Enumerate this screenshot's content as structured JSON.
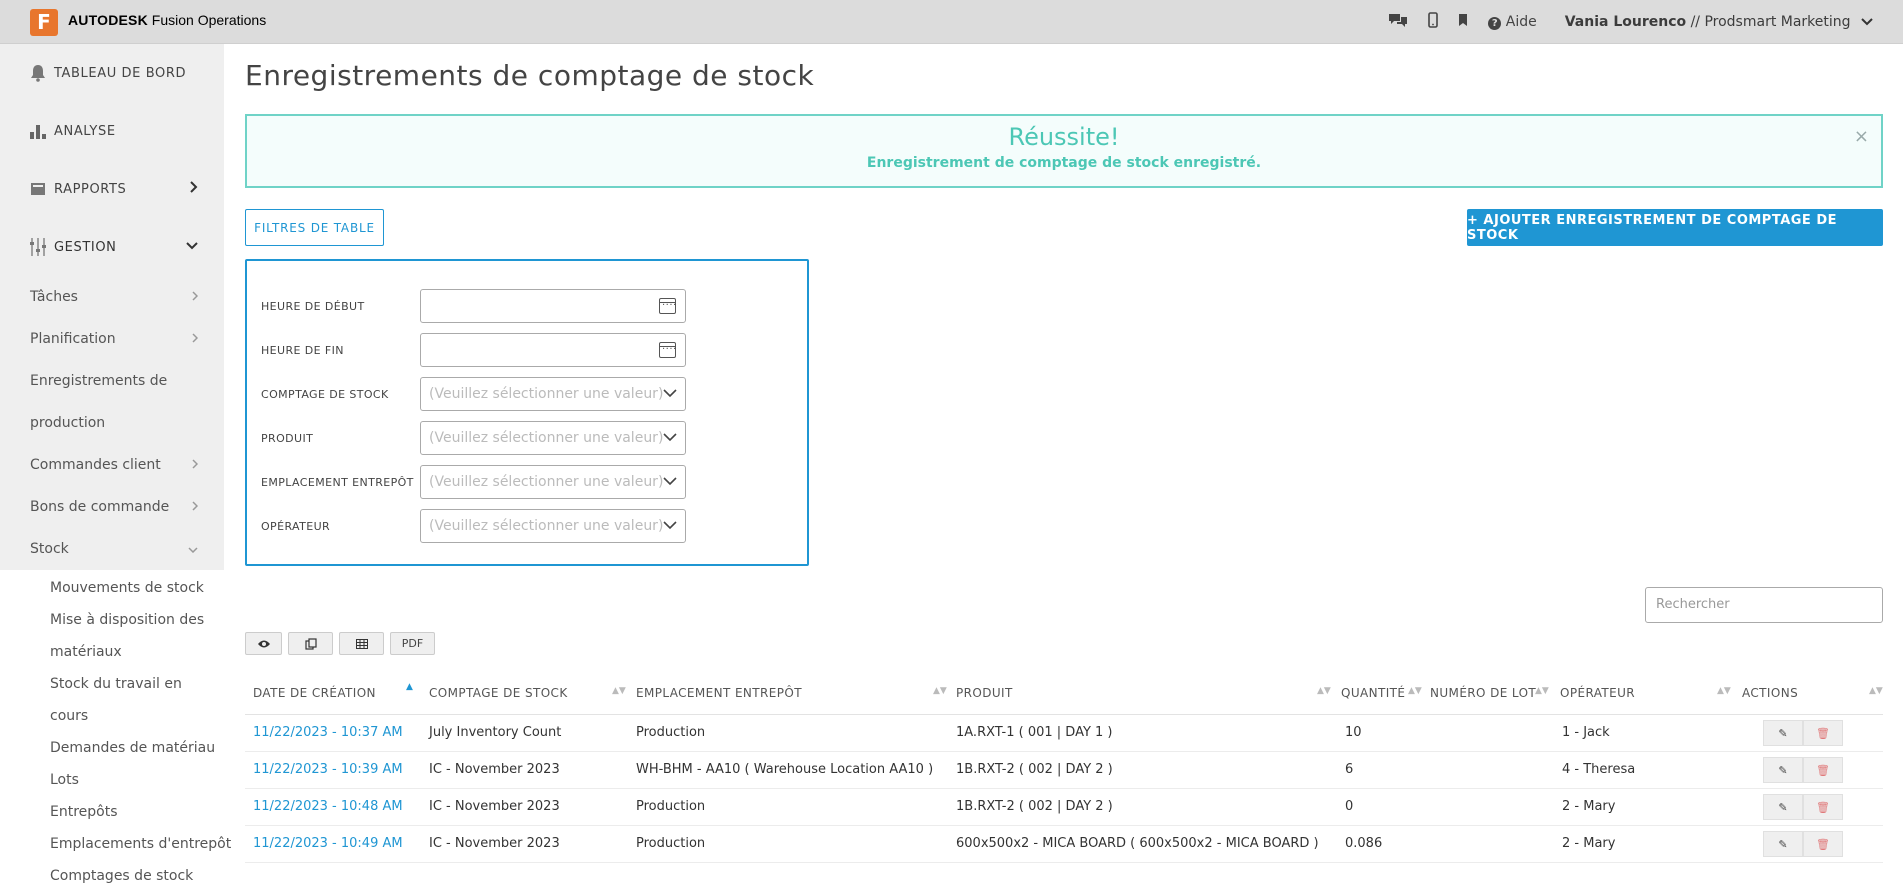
{
  "topbar": {
    "logo_letter": "F",
    "brand_bold": "AUTODESK",
    "brand_rest": "Fusion Operations",
    "help_label": "Aide",
    "user_name": "Vania Lourenco",
    "user_org": " // Prodsmart Marketing"
  },
  "sidebar": {
    "main": [
      {
        "label": "TABLEAU DE BORD",
        "icon": "bell-icon"
      },
      {
        "label": "ANALYSE",
        "icon": "bar-chart-icon"
      },
      {
        "label": "RAPPORTS",
        "icon": "book-icon"
      },
      {
        "label": "GESTION",
        "icon": "sliders-icon"
      }
    ],
    "sub": [
      {
        "label": "Tâches"
      },
      {
        "label": "Planification"
      },
      {
        "label": "Enregistrements de production"
      },
      {
        "label": "Commandes client"
      },
      {
        "label": "Bons de commande"
      },
      {
        "label": "Stock"
      }
    ],
    "stock_items": [
      "Mouvements de stock",
      "Mise à disposition des",
      "matériaux",
      "Stock du travail en cours",
      "Demandes de matériau",
      "Lots",
      "Entrepôts",
      "Emplacements d'entrepôt",
      "Comptages de stock"
    ]
  },
  "page": {
    "title": "Enregistrements de comptage de stock"
  },
  "alert": {
    "heading": "Réussite!",
    "message": "Enregistrement de comptage de stock enregistré.",
    "close": "×"
  },
  "buttons": {
    "filters": "FILTRES DE TABLE",
    "add": "+ AJOUTER ENREGISTREMENT DE COMPTAGE DE STOCK"
  },
  "filters": [
    {
      "label": "HEURE DE DÉBUT",
      "type": "date",
      "placeholder": ""
    },
    {
      "label": "HEURE DE FIN",
      "type": "date",
      "placeholder": ""
    },
    {
      "label": "COMPTAGE DE STOCK",
      "type": "select",
      "placeholder": "(Veuillez sélectionner une valeur)"
    },
    {
      "label": "PRODUIT",
      "type": "select",
      "placeholder": "(Veuillez sélectionner une valeur)"
    },
    {
      "label": "EMPLACEMENT ENTREPÔT",
      "type": "select",
      "placeholder": "(Veuillez sélectionner une valeur)"
    },
    {
      "label": "OPÉRATEUR",
      "type": "select",
      "placeholder": "(Veuillez sélectionner une valeur)"
    }
  ],
  "search": {
    "placeholder": "Rechercher"
  },
  "tools": {
    "pdf": "PDF"
  },
  "table": {
    "columns": [
      "DATE DE CRÉATION",
      "COMPTAGE DE STOCK",
      "EMPLACEMENT ENTREPÔT",
      "PRODUIT",
      "QUANTITÉ",
      "NUMÉRO DE LOT",
      "OPÉRATEUR",
      "ACTIONS"
    ],
    "rows": [
      {
        "date": "11/22/2023 - 10:37 AM",
        "count": "July Inventory Count",
        "location": "Production",
        "product": "1A.RXT-1 ( 001 | DAY 1 )",
        "qty": "10",
        "lot": "",
        "operator": "1 - Jack"
      },
      {
        "date": "11/22/2023 - 10:39 AM",
        "count": "IC - November 2023",
        "location": "WH-BHM - AA10 ( Warehouse Location AA10 )",
        "product": "1B.RXT-2 ( 002 | DAY 2 )",
        "qty": "6",
        "lot": "",
        "operator": "4 - Theresa"
      },
      {
        "date": "11/22/2023 - 10:48 AM",
        "count": "IC - November 2023",
        "location": "Production",
        "product": "1B.RXT-2 ( 002 | DAY 2 )",
        "qty": "0",
        "lot": "",
        "operator": "2 - Mary"
      },
      {
        "date": "11/22/2023 - 10:49 AM",
        "count": "IC - November 2023",
        "location": "Production",
        "product": "600x500x2 - MICA BOARD ( 600x500x2 - MICA BOARD )",
        "qty": "0.086",
        "lot": "",
        "operator": "2 - Mary"
      }
    ]
  },
  "colors": {
    "accent": "#1f96d3",
    "success": "#4cc7b5",
    "danger": "#e0797a",
    "logo": "#e8762d"
  }
}
